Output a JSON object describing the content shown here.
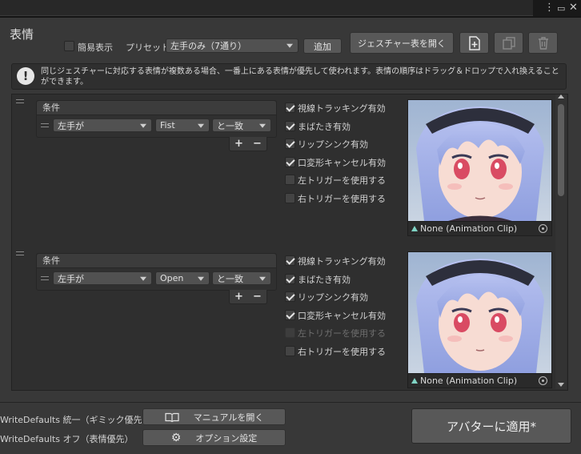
{
  "header": {
    "title": "表情",
    "simple_label": "簡易表示",
    "preset_label": "プリセット",
    "preset_value": "左手のみ（7通り）",
    "add_label": "追加",
    "open_table_label": "ジェスチャー表を開く"
  },
  "info": {
    "message": "同じジェスチャーに対応する表情が複数ある場合、一番上にある表情が優先して使われます。表情の順序はドラッグ＆ドロップで入れ換えることができます。"
  },
  "entries": [
    {
      "condition_title": "条件",
      "hand": "左手が",
      "gesture": "Fist",
      "match": "と一致",
      "toggles": [
        {
          "label": "視線トラッキング有効",
          "checked": true,
          "disabled": false
        },
        {
          "label": "まばたき有効",
          "checked": true,
          "disabled": false
        },
        {
          "label": "リップシンク有効",
          "checked": true,
          "disabled": false
        },
        {
          "label": "口変形キャンセル有効",
          "checked": true,
          "disabled": false
        },
        {
          "label": "左トリガーを使用する",
          "checked": false,
          "disabled": false
        },
        {
          "label": "右トリガーを使用する",
          "checked": false,
          "disabled": false
        }
      ],
      "clip": "None (Animation Clip)"
    },
    {
      "condition_title": "条件",
      "hand": "左手が",
      "gesture": "Open",
      "match": "と一致",
      "toggles": [
        {
          "label": "視線トラッキング有効",
          "checked": true,
          "disabled": false
        },
        {
          "label": "まばたき有効",
          "checked": true,
          "disabled": false
        },
        {
          "label": "リップシンク有効",
          "checked": true,
          "disabled": false
        },
        {
          "label": "口変形キャンセル有効",
          "checked": true,
          "disabled": false
        },
        {
          "label": "左トリガーを使用する",
          "checked": false,
          "disabled": true
        },
        {
          "label": "右トリガーを使用する",
          "checked": false,
          "disabled": false
        }
      ],
      "clip": "None (Animation Clip)"
    }
  ],
  "footer": {
    "wd_unified": "WriteDefaults 統一（ギミック優先）",
    "wd_off": "WriteDefaults オフ（表情優先）",
    "manual_label": "マニュアルを開く",
    "options_label": "オプション設定",
    "apply_label": "アバターに適用*"
  },
  "colors": {
    "background": "#383838",
    "panel": "#2f2f2f",
    "button": "#585858",
    "hair": "#a9b6ec",
    "eye": "#d94b63",
    "clip_icon": "#7fd3c4"
  }
}
